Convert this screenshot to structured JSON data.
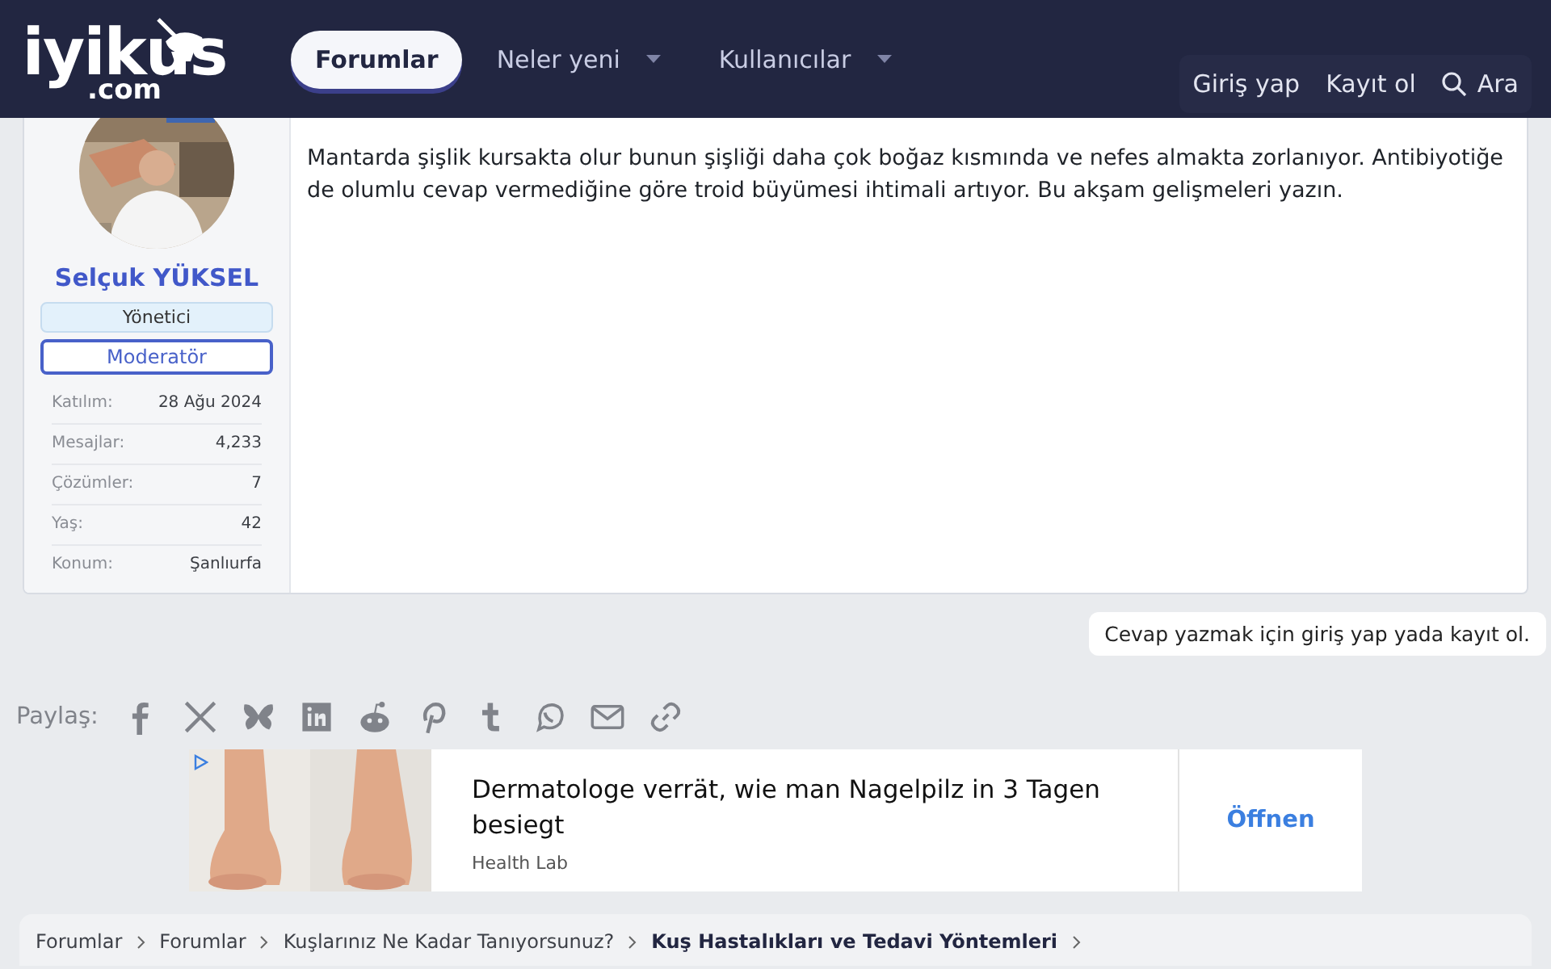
{
  "header": {
    "logo": {
      "name": "iyikus",
      "domain": ".com"
    },
    "nav": [
      {
        "label": "Forumlar",
        "selected": true,
        "has_menu": false
      },
      {
        "label": "Neler yeni",
        "selected": false,
        "has_menu": true
      },
      {
        "label": "Kullanıcılar",
        "selected": false,
        "has_menu": true
      }
    ],
    "account": [
      "Giriş yap",
      "Kayıt ol"
    ],
    "search": "Ara"
  },
  "post": {
    "author": {
      "name": "Selçuk YÜKSEL",
      "banners": [
        {
          "label": "Yönetici",
          "kind": "filled"
        },
        {
          "label": "Moderatör",
          "kind": "outlined"
        }
      ],
      "stats": [
        {
          "label": "Katılım:",
          "value": "28 Ağu 2024"
        },
        {
          "label": "Mesajlar:",
          "value": "4,233"
        },
        {
          "label": "Çözümler:",
          "value": "7"
        },
        {
          "label": "Yaş:",
          "value": "42"
        },
        {
          "label": "Konum:",
          "value": "Şanlıurfa"
        }
      ]
    },
    "message": "Mantarda şişlik kursakta olur bunun şişliği daha çok boğaz kısmında ve nefes almakta zorlanıyor. Antibiyotiğe de olumlu cevap vermediğine göre troid büyümesi ihtimali artıyor. Bu akşam gelişmeleri yazın."
  },
  "reply_notice": "Cevap yazmak için giriş yap yada kayıt ol.",
  "share": {
    "label": "Paylaş:"
  },
  "ad": {
    "headline": "Dermatologe verrät, wie man Nagelpilz in 3 Tagen besiegt",
    "source": "Health Lab",
    "button": "Öffnen"
  },
  "breadcrumb": [
    "Forumlar",
    "Forumlar",
    "Kuşlarınız Ne Kadar Tanıyorsunuz?",
    "Kuş Hastalıkları ve Tedavi Yöntemleri"
  ]
}
